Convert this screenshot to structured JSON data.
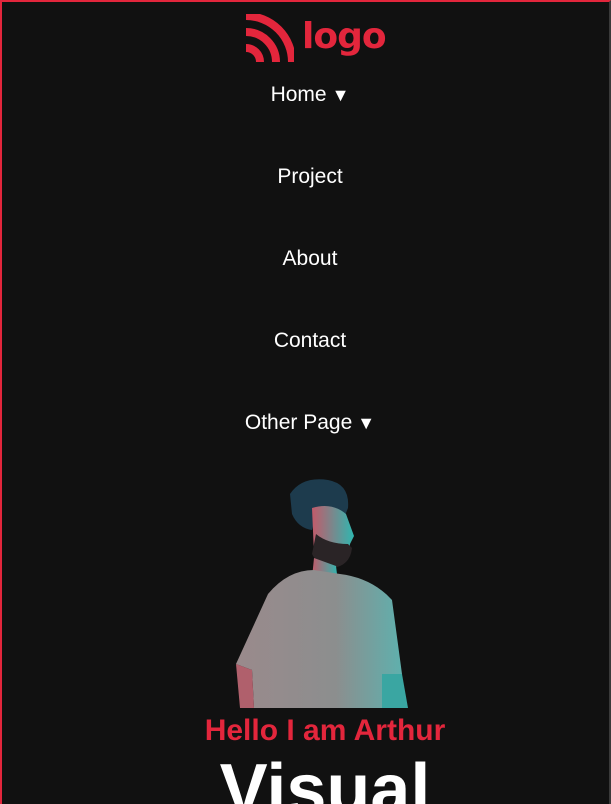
{
  "brand": {
    "logo_text": "logo",
    "logo_icon": "wifi-arcs-icon",
    "accent_color": "#e3263c"
  },
  "nav": {
    "items": [
      {
        "label": "Home",
        "has_dropdown": true,
        "caret": "▼"
      },
      {
        "label": "Project",
        "has_dropdown": false
      },
      {
        "label": "About",
        "has_dropdown": false
      },
      {
        "label": "Contact",
        "has_dropdown": false
      },
      {
        "label": "Other Page",
        "has_dropdown": true,
        "caret": "▼"
      }
    ]
  },
  "hero": {
    "greeting": "Hello I am Arthur",
    "headline": "Visual"
  }
}
